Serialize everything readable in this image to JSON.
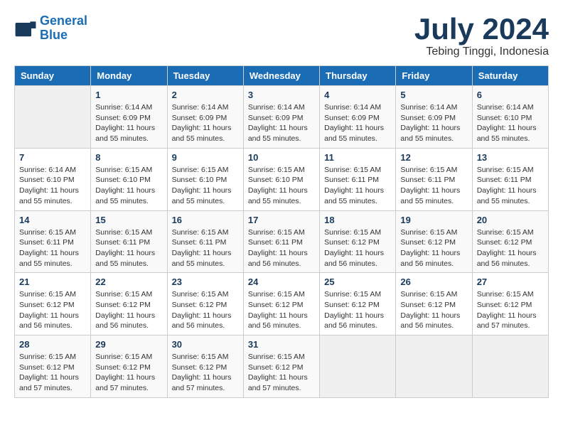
{
  "header": {
    "logo_line1": "General",
    "logo_line2": "Blue",
    "month_year": "July 2024",
    "location": "Tebing Tinggi, Indonesia"
  },
  "days_of_week": [
    "Sunday",
    "Monday",
    "Tuesday",
    "Wednesday",
    "Thursday",
    "Friday",
    "Saturday"
  ],
  "weeks": [
    [
      {
        "day": "",
        "info": ""
      },
      {
        "day": "1",
        "info": "Sunrise: 6:14 AM\nSunset: 6:09 PM\nDaylight: 11 hours\nand 55 minutes."
      },
      {
        "day": "2",
        "info": "Sunrise: 6:14 AM\nSunset: 6:09 PM\nDaylight: 11 hours\nand 55 minutes."
      },
      {
        "day": "3",
        "info": "Sunrise: 6:14 AM\nSunset: 6:09 PM\nDaylight: 11 hours\nand 55 minutes."
      },
      {
        "day": "4",
        "info": "Sunrise: 6:14 AM\nSunset: 6:09 PM\nDaylight: 11 hours\nand 55 minutes."
      },
      {
        "day": "5",
        "info": "Sunrise: 6:14 AM\nSunset: 6:09 PM\nDaylight: 11 hours\nand 55 minutes."
      },
      {
        "day": "6",
        "info": "Sunrise: 6:14 AM\nSunset: 6:10 PM\nDaylight: 11 hours\nand 55 minutes."
      }
    ],
    [
      {
        "day": "7",
        "info": "Sunrise: 6:14 AM\nSunset: 6:10 PM\nDaylight: 11 hours\nand 55 minutes."
      },
      {
        "day": "8",
        "info": "Sunrise: 6:15 AM\nSunset: 6:10 PM\nDaylight: 11 hours\nand 55 minutes."
      },
      {
        "day": "9",
        "info": "Sunrise: 6:15 AM\nSunset: 6:10 PM\nDaylight: 11 hours\nand 55 minutes."
      },
      {
        "day": "10",
        "info": "Sunrise: 6:15 AM\nSunset: 6:10 PM\nDaylight: 11 hours\nand 55 minutes."
      },
      {
        "day": "11",
        "info": "Sunrise: 6:15 AM\nSunset: 6:11 PM\nDaylight: 11 hours\nand 55 minutes."
      },
      {
        "day": "12",
        "info": "Sunrise: 6:15 AM\nSunset: 6:11 PM\nDaylight: 11 hours\nand 55 minutes."
      },
      {
        "day": "13",
        "info": "Sunrise: 6:15 AM\nSunset: 6:11 PM\nDaylight: 11 hours\nand 55 minutes."
      }
    ],
    [
      {
        "day": "14",
        "info": "Sunrise: 6:15 AM\nSunset: 6:11 PM\nDaylight: 11 hours\nand 55 minutes."
      },
      {
        "day": "15",
        "info": "Sunrise: 6:15 AM\nSunset: 6:11 PM\nDaylight: 11 hours\nand 55 minutes."
      },
      {
        "day": "16",
        "info": "Sunrise: 6:15 AM\nSunset: 6:11 PM\nDaylight: 11 hours\nand 55 minutes."
      },
      {
        "day": "17",
        "info": "Sunrise: 6:15 AM\nSunset: 6:11 PM\nDaylight: 11 hours\nand 56 minutes."
      },
      {
        "day": "18",
        "info": "Sunrise: 6:15 AM\nSunset: 6:12 PM\nDaylight: 11 hours\nand 56 minutes."
      },
      {
        "day": "19",
        "info": "Sunrise: 6:15 AM\nSunset: 6:12 PM\nDaylight: 11 hours\nand 56 minutes."
      },
      {
        "day": "20",
        "info": "Sunrise: 6:15 AM\nSunset: 6:12 PM\nDaylight: 11 hours\nand 56 minutes."
      }
    ],
    [
      {
        "day": "21",
        "info": "Sunrise: 6:15 AM\nSunset: 6:12 PM\nDaylight: 11 hours\nand 56 minutes."
      },
      {
        "day": "22",
        "info": "Sunrise: 6:15 AM\nSunset: 6:12 PM\nDaylight: 11 hours\nand 56 minutes."
      },
      {
        "day": "23",
        "info": "Sunrise: 6:15 AM\nSunset: 6:12 PM\nDaylight: 11 hours\nand 56 minutes."
      },
      {
        "day": "24",
        "info": "Sunrise: 6:15 AM\nSunset: 6:12 PM\nDaylight: 11 hours\nand 56 minutes."
      },
      {
        "day": "25",
        "info": "Sunrise: 6:15 AM\nSunset: 6:12 PM\nDaylight: 11 hours\nand 56 minutes."
      },
      {
        "day": "26",
        "info": "Sunrise: 6:15 AM\nSunset: 6:12 PM\nDaylight: 11 hours\nand 56 minutes."
      },
      {
        "day": "27",
        "info": "Sunrise: 6:15 AM\nSunset: 6:12 PM\nDaylight: 11 hours\nand 57 minutes."
      }
    ],
    [
      {
        "day": "28",
        "info": "Sunrise: 6:15 AM\nSunset: 6:12 PM\nDaylight: 11 hours\nand 57 minutes."
      },
      {
        "day": "29",
        "info": "Sunrise: 6:15 AM\nSunset: 6:12 PM\nDaylight: 11 hours\nand 57 minutes."
      },
      {
        "day": "30",
        "info": "Sunrise: 6:15 AM\nSunset: 6:12 PM\nDaylight: 11 hours\nand 57 minutes."
      },
      {
        "day": "31",
        "info": "Sunrise: 6:15 AM\nSunset: 6:12 PM\nDaylight: 11 hours\nand 57 minutes."
      },
      {
        "day": "",
        "info": ""
      },
      {
        "day": "",
        "info": ""
      },
      {
        "day": "",
        "info": ""
      }
    ]
  ]
}
